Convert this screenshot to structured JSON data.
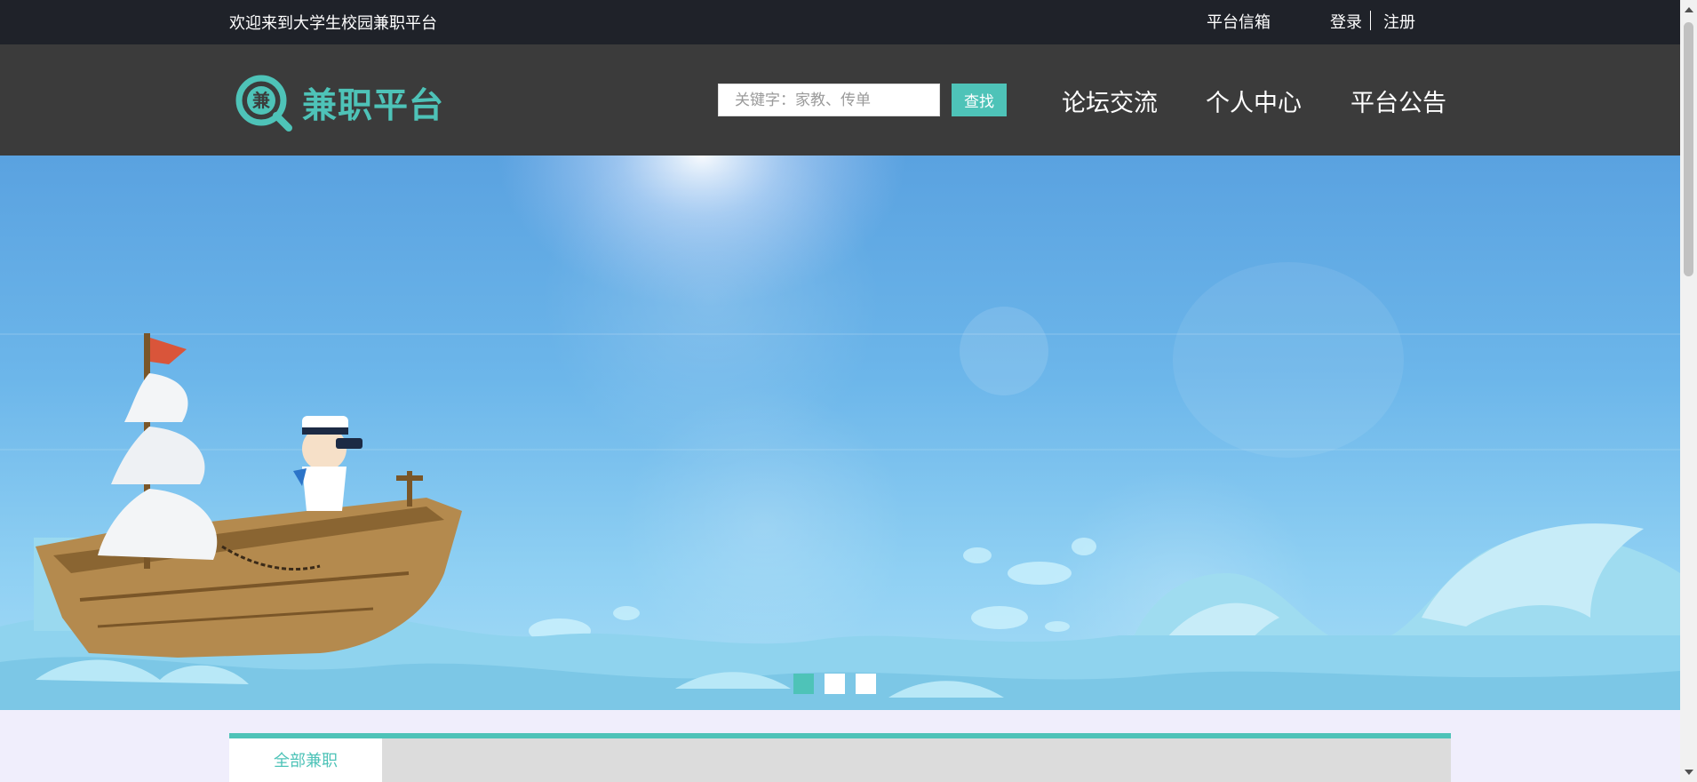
{
  "topbar": {
    "welcome": "欢迎来到大学生校园兼职平台",
    "mailbox": "平台信箱",
    "login": "登录",
    "register": "注册"
  },
  "header": {
    "logo_char": "兼",
    "logo_text": "兼职平台",
    "search_placeholder": "关键字：家教、传单",
    "search_button": "查找",
    "nav": [
      "论坛交流",
      "个人中心",
      "平台公告"
    ]
  },
  "banner": {
    "slide_count": 3,
    "active_slide": 1
  },
  "content": {
    "tab_all": "全部兼职"
  },
  "colors": {
    "accent": "#4ec3b8",
    "topbar_bg": "#1f2229",
    "header_bg": "#3b3b3b",
    "page_bg": "#f0eefc"
  }
}
